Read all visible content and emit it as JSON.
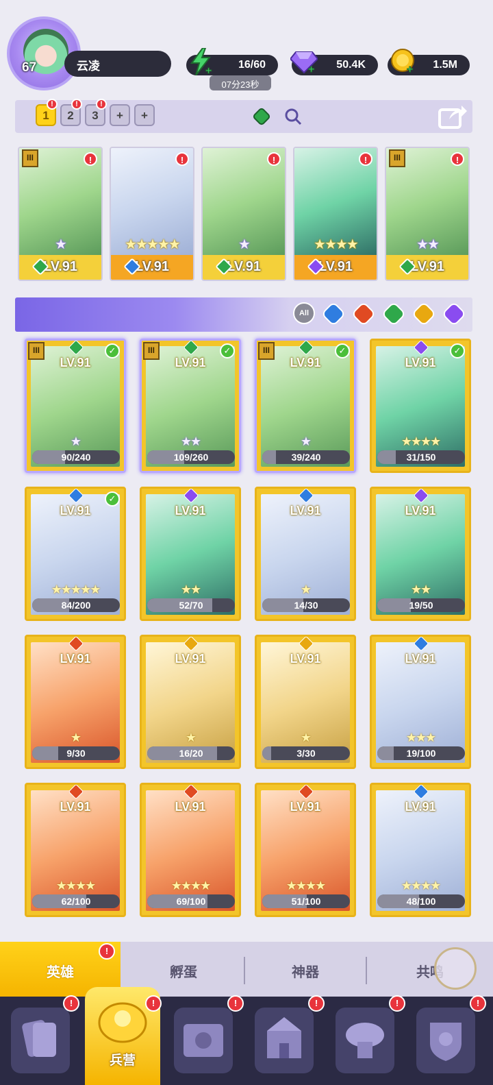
{
  "player": {
    "level": "67",
    "name": "云凌"
  },
  "resources": {
    "energy": "16/60",
    "energy_timer": "07分23秒",
    "gems": "50.4K",
    "gold": "1.5M"
  },
  "team_tabs": {
    "tabs": [
      "1",
      "2",
      "3",
      "+",
      "+"
    ],
    "active": "1",
    "alert_glyph": "!"
  },
  "team_heroes": [
    {
      "level": "LV.91",
      "stars": 1,
      "star_type": "purple",
      "element": "green",
      "rank": "III",
      "alert": true,
      "band_color": "#f4d03a"
    },
    {
      "level": "LV.91",
      "stars": 5,
      "star_type": "gold",
      "element": "blue",
      "rank": "",
      "alert": true,
      "band_color": "#f5a623"
    },
    {
      "level": "LV.91",
      "stars": 1,
      "star_type": "purple",
      "element": "green",
      "rank": "",
      "alert": true,
      "band_color": "#f4d03a"
    },
    {
      "level": "LV.91",
      "stars": 4,
      "star_type": "gold",
      "element": "purple",
      "rank": "",
      "alert": true,
      "band_color": "#f5a623"
    },
    {
      "level": "LV.91",
      "stars": 2,
      "star_type": "purple",
      "element": "green",
      "rank": "III",
      "alert": true,
      "band_color": "#f4d03a"
    }
  ],
  "filters": {
    "all_label": "All",
    "elements": [
      "blue",
      "red",
      "green",
      "gold",
      "purple"
    ]
  },
  "heroes": [
    {
      "level": "LV.91",
      "element": "green",
      "progress": "90/240",
      "progress_frac": 0.375,
      "stars": 1,
      "star_type": "purple",
      "rank": "III",
      "selected": true
    },
    {
      "level": "LV.91",
      "element": "green",
      "progress": "109/260",
      "progress_frac": 0.42,
      "stars": 2,
      "star_type": "purple",
      "rank": "III",
      "selected": true
    },
    {
      "level": "LV.91",
      "element": "green",
      "progress": "39/240",
      "progress_frac": 0.16,
      "stars": 1,
      "star_type": "purple",
      "rank": "III",
      "selected": true
    },
    {
      "level": "LV.91",
      "element": "purple",
      "progress": "31/150",
      "progress_frac": 0.21,
      "stars": 4,
      "star_type": "gold",
      "rank": "",
      "selected": true
    },
    {
      "level": "LV.91",
      "element": "blue",
      "progress": "84/200",
      "progress_frac": 0.42,
      "stars": 5,
      "star_type": "gold",
      "rank": "",
      "selected": true
    },
    {
      "level": "LV.91",
      "element": "purple",
      "progress": "52/70",
      "progress_frac": 0.74,
      "stars": 2,
      "star_type": "gold",
      "rank": "",
      "selected": false
    },
    {
      "level": "LV.91",
      "element": "blue",
      "progress": "14/30",
      "progress_frac": 0.47,
      "stars": 1,
      "star_type": "gold",
      "rank": "",
      "selected": false
    },
    {
      "level": "LV.91",
      "element": "purple",
      "progress": "19/50",
      "progress_frac": 0.38,
      "stars": 2,
      "star_type": "gold",
      "rank": "",
      "selected": false
    },
    {
      "level": "LV.91",
      "element": "red",
      "progress": "9/30",
      "progress_frac": 0.3,
      "stars": 1,
      "star_type": "gold",
      "rank": "",
      "selected": false
    },
    {
      "level": "LV.91",
      "element": "gold",
      "progress": "16/20",
      "progress_frac": 0.8,
      "stars": 1,
      "star_type": "gold",
      "rank": "",
      "selected": false
    },
    {
      "level": "LV.91",
      "element": "gold",
      "progress": "3/30",
      "progress_frac": 0.1,
      "stars": 1,
      "star_type": "gold",
      "rank": "",
      "selected": false
    },
    {
      "level": "LV.91",
      "element": "blue",
      "progress": "19/100",
      "progress_frac": 0.19,
      "stars": 3,
      "star_type": "gold",
      "rank": "",
      "selected": false
    },
    {
      "level": "LV.91",
      "element": "red",
      "progress": "62/100",
      "progress_frac": 0.62,
      "stars": 4,
      "star_type": "gold",
      "rank": "",
      "selected": false
    },
    {
      "level": "LV.91",
      "element": "red",
      "progress": "69/100",
      "progress_frac": 0.69,
      "stars": 4,
      "star_type": "gold",
      "rank": "",
      "selected": false
    },
    {
      "level": "LV.91",
      "element": "red",
      "progress": "51/100",
      "progress_frac": 0.51,
      "stars": 4,
      "star_type": "gold",
      "rank": "",
      "selected": false
    },
    {
      "level": "LV.91",
      "element": "blue",
      "progress": "48/100",
      "progress_frac": 0.48,
      "stars": 4,
      "star_type": "gold",
      "rank": "",
      "selected": false
    }
  ],
  "category_tabs": [
    {
      "label": "英雄",
      "active": true,
      "alert": true
    },
    {
      "label": "孵蛋",
      "active": false,
      "alert": false
    },
    {
      "label": "神器",
      "active": false,
      "alert": false
    },
    {
      "label": "共鸣",
      "active": false,
      "alert": false
    }
  ],
  "bottom_nav": {
    "active_label": "兵营",
    "items": [
      "cards-icon",
      "barracks-icon",
      "map-icon",
      "castle-icon",
      "tower-icon",
      "shield-icon"
    ]
  },
  "colors": {
    "green": "#2fa84a",
    "blue": "#2f7de0",
    "red": "#e04a22",
    "gold": "#e8a810",
    "purple": "#8a4cf0",
    "accent_yellow": "#ffd21a"
  }
}
